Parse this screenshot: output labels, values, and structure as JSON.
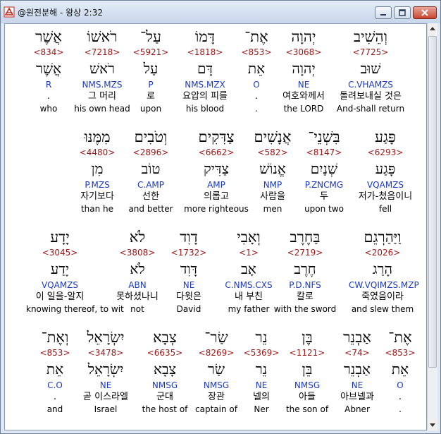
{
  "window": {
    "title": "@원전분해 - 왕상 2:32"
  },
  "rows": [
    [
      {
        "heb": "וְהֵשִׁיב",
        "strong": "<7725>",
        "root": "שׁוּב",
        "morph": "C.VHAMZS",
        "kor": "돌려보내실 것은",
        "eng": "And-shall return",
        "hl": true
      },
      {
        "heb": "יְהוָה",
        "strong": "<3068>",
        "root": "יְהוָה",
        "morph": "NE",
        "kor": "여호와께서",
        "eng": "the LORD"
      },
      {
        "heb": "אֶת־",
        "strong": "<853>",
        "root": "אֵת",
        "morph": "O",
        "kor": ".",
        "eng": "."
      },
      {
        "heb": "דָּמוֹ",
        "strong": "<1818>",
        "root": "דָּם",
        "morph": "NMS.MZX",
        "kor": "요압의 피를",
        "eng": "his blood"
      },
      {
        "heb": "עַל־",
        "strong": "<5921>",
        "root": "עַל",
        "morph": "P",
        "kor": "로",
        "eng": "upon"
      },
      {
        "heb": "רֹאשׁוֹ",
        "strong": "<7218>",
        "root": "רֹאשׁ",
        "morph": "NMS.MZS",
        "kor": "그 머리",
        "eng": "his own head"
      },
      {
        "heb": "אֲשֶׁר",
        "strong": "<834>",
        "root": "אֲשֶׁר",
        "morph": "R",
        "kor": ".",
        "eng": "who"
      }
    ],
    [
      {
        "heb": "פָּגַע",
        "strong": "<6293>",
        "root": "פָּגַע",
        "morph": "VQAMZS",
        "kor": "저가-첬음이니",
        "eng": "fell"
      },
      {
        "heb": "בִּשְׁנֵי־",
        "strong": "<8147>",
        "root": "שְׁנַיִם",
        "morph": "P.ZNCMG",
        "kor": "두",
        "eng": "upon two"
      },
      {
        "heb": "אֲנָשִׁים",
        "strong": "<582>",
        "root": "אֱנוֹשׁ",
        "morph": "NMP",
        "kor": "사람을",
        "eng": "men"
      },
      {
        "heb": "צַדִּקִים",
        "strong": "<6662>",
        "root": "צַדִּיק",
        "morph": "AMP",
        "kor": "의롭고",
        "eng": "more righteous"
      },
      {
        "heb": "וְטֹבִים",
        "strong": "<2896>",
        "root": "טוֹב",
        "morph": "C.AMP",
        "kor": "선한",
        "eng": "and better"
      },
      {
        "heb": "מִמֶּנּוּ",
        "strong": "<4480>",
        "root": "מִן",
        "morph": "P.MZS",
        "kor": "자기보다",
        "eng": "than he"
      }
    ],
    [
      {
        "heb": "וַיַּהַרְגֵם",
        "strong": "<2026>",
        "root": "הָרַג",
        "morph": "CW.VQIMZS.MZP",
        "kor": "죽였음이라",
        "eng": "and slew them"
      },
      {
        "heb": "בַּחֶרֶב",
        "strong": "<2719>",
        "root": "חֶרֶב",
        "morph": "P.D.NFS",
        "kor": "칼로",
        "eng": "with the sword"
      },
      {
        "heb": "וְאָבִי",
        "strong": "<1>",
        "root": "אָב",
        "morph": "C.NMS.CXS",
        "kor": "내 부친",
        "eng": "my father"
      },
      {
        "heb": "דָוִד",
        "strong": "<1732>",
        "root": "דָּוִד",
        "morph": "NE",
        "kor": "다윗은",
        "eng": "David"
      },
      {
        "heb": "לֹא",
        "strong": "<3808>",
        "root": "לֹא",
        "morph": "ABN",
        "kor": "못하셨나니",
        "eng": "not"
      },
      {
        "heb": "יָדָע",
        "strong": "<3045>",
        "root": "יָדַע",
        "morph": "VQAMZS",
        "kor": "이 일을-알지",
        "eng": "knowing thereof, to wit"
      }
    ],
    [
      {
        "heb": "אֶת־",
        "strong": "<853>",
        "root": "אֵת",
        "morph": "O",
        "kor": ".",
        "eng": "."
      },
      {
        "heb": "אַבְנֵר",
        "strong": "<74>",
        "root": "אַבְנֵר",
        "morph": "NE",
        "kor": "아브넬과",
        "eng": "Abner"
      },
      {
        "heb": "בֶּן",
        "strong": "<1121>",
        "root": "בֵּן",
        "morph": "NMSG",
        "kor": "아들",
        "eng": "the son of"
      },
      {
        "heb": "נֵר",
        "strong": "<5369>",
        "root": "נֵר",
        "morph": "NE",
        "kor": "넬의",
        "eng": "Ner"
      },
      {
        "heb": "שַׂר־",
        "strong": "<8269>",
        "root": "שַׂר",
        "morph": "NMSG",
        "kor": "장관",
        "eng": "captain of"
      },
      {
        "heb": "צְבָא",
        "strong": "<6635>",
        "root": "צָבָא",
        "morph": "NMSG",
        "kor": "군대",
        "eng": "the host of"
      },
      {
        "heb": "יִשְׂרָאֵל",
        "strong": "<3478>",
        "root": "יִשְׂרָאֵל",
        "morph": "NE",
        "kor": "곧 이스라엘",
        "eng": "Israel"
      },
      {
        "heb": "וְאֶת־",
        "strong": "<853>",
        "root": "אֵת",
        "morph": "C.O",
        "kor": ".",
        "eng": "and"
      }
    ]
  ]
}
